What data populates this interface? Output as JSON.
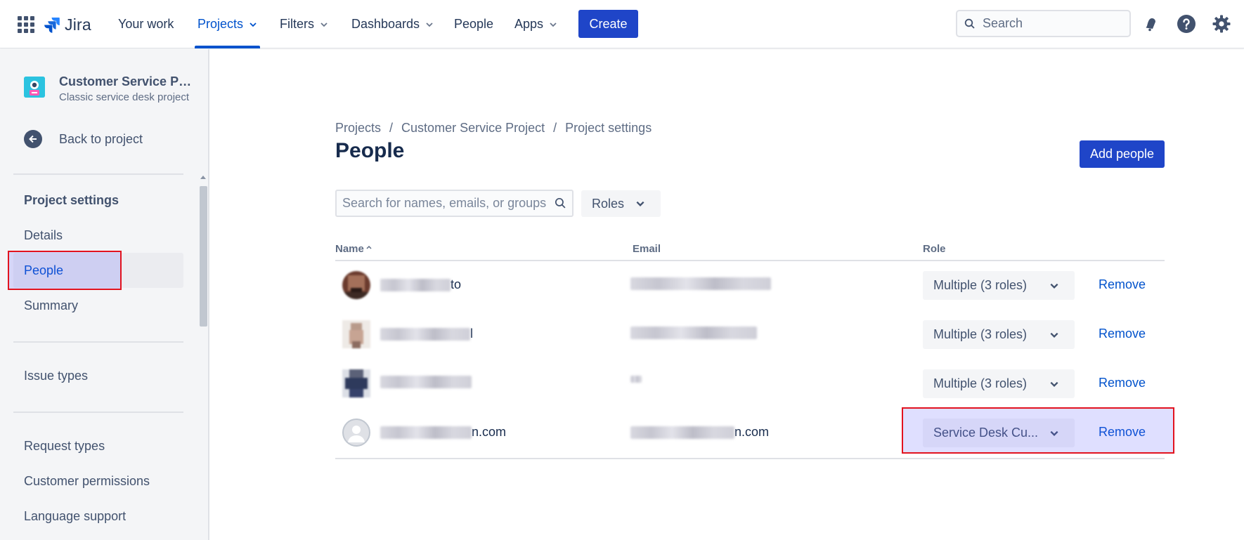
{
  "topnav": {
    "logo_text": "Jira",
    "items": [
      {
        "label": "Your work"
      },
      {
        "label": "Projects"
      },
      {
        "label": "Filters"
      },
      {
        "label": "Dashboards"
      },
      {
        "label": "People"
      },
      {
        "label": "Apps"
      }
    ],
    "create_label": "Create",
    "search_placeholder": "Search"
  },
  "sidebar": {
    "project_name": "Customer Service Pr...",
    "project_type": "Classic service desk project",
    "back_label": "Back to project",
    "section_heading": "Project settings",
    "items": [
      {
        "label": "Details"
      },
      {
        "label": "People"
      },
      {
        "label": "Summary"
      },
      {
        "label": "Issue types"
      },
      {
        "label": "Request types"
      },
      {
        "label": "Customer permissions"
      },
      {
        "label": "Language support"
      }
    ]
  },
  "main": {
    "breadcrumb": [
      "Projects",
      "Customer Service Project",
      "Project settings"
    ],
    "breadcrumb_sep": "/",
    "title": "People",
    "add_people_label": "Add people",
    "search_placeholder": "Search for names, emails, or groups",
    "roles_filter_label": "Roles",
    "columns": {
      "name": "Name",
      "email": "Email",
      "role": "Role"
    },
    "rows": [
      {
        "name_suffix": "to",
        "email_suffix": "",
        "role": "Multiple (3 roles)",
        "action": "Remove"
      },
      {
        "name_suffix": "l",
        "email_suffix": "",
        "role": "Multiple (3 roles)",
        "action": "Remove"
      },
      {
        "name_suffix": "",
        "email_suffix": "",
        "role": "Multiple (3 roles)",
        "action": "Remove"
      },
      {
        "name_suffix": "n.com",
        "email_suffix": "n.com",
        "role": "Service Desk Cu...",
        "action": "Remove"
      }
    ]
  },
  "colors": {
    "brand_blue": "#0052CC",
    "button_blue": "#1F45C8",
    "highlight_border": "#E2131F"
  }
}
